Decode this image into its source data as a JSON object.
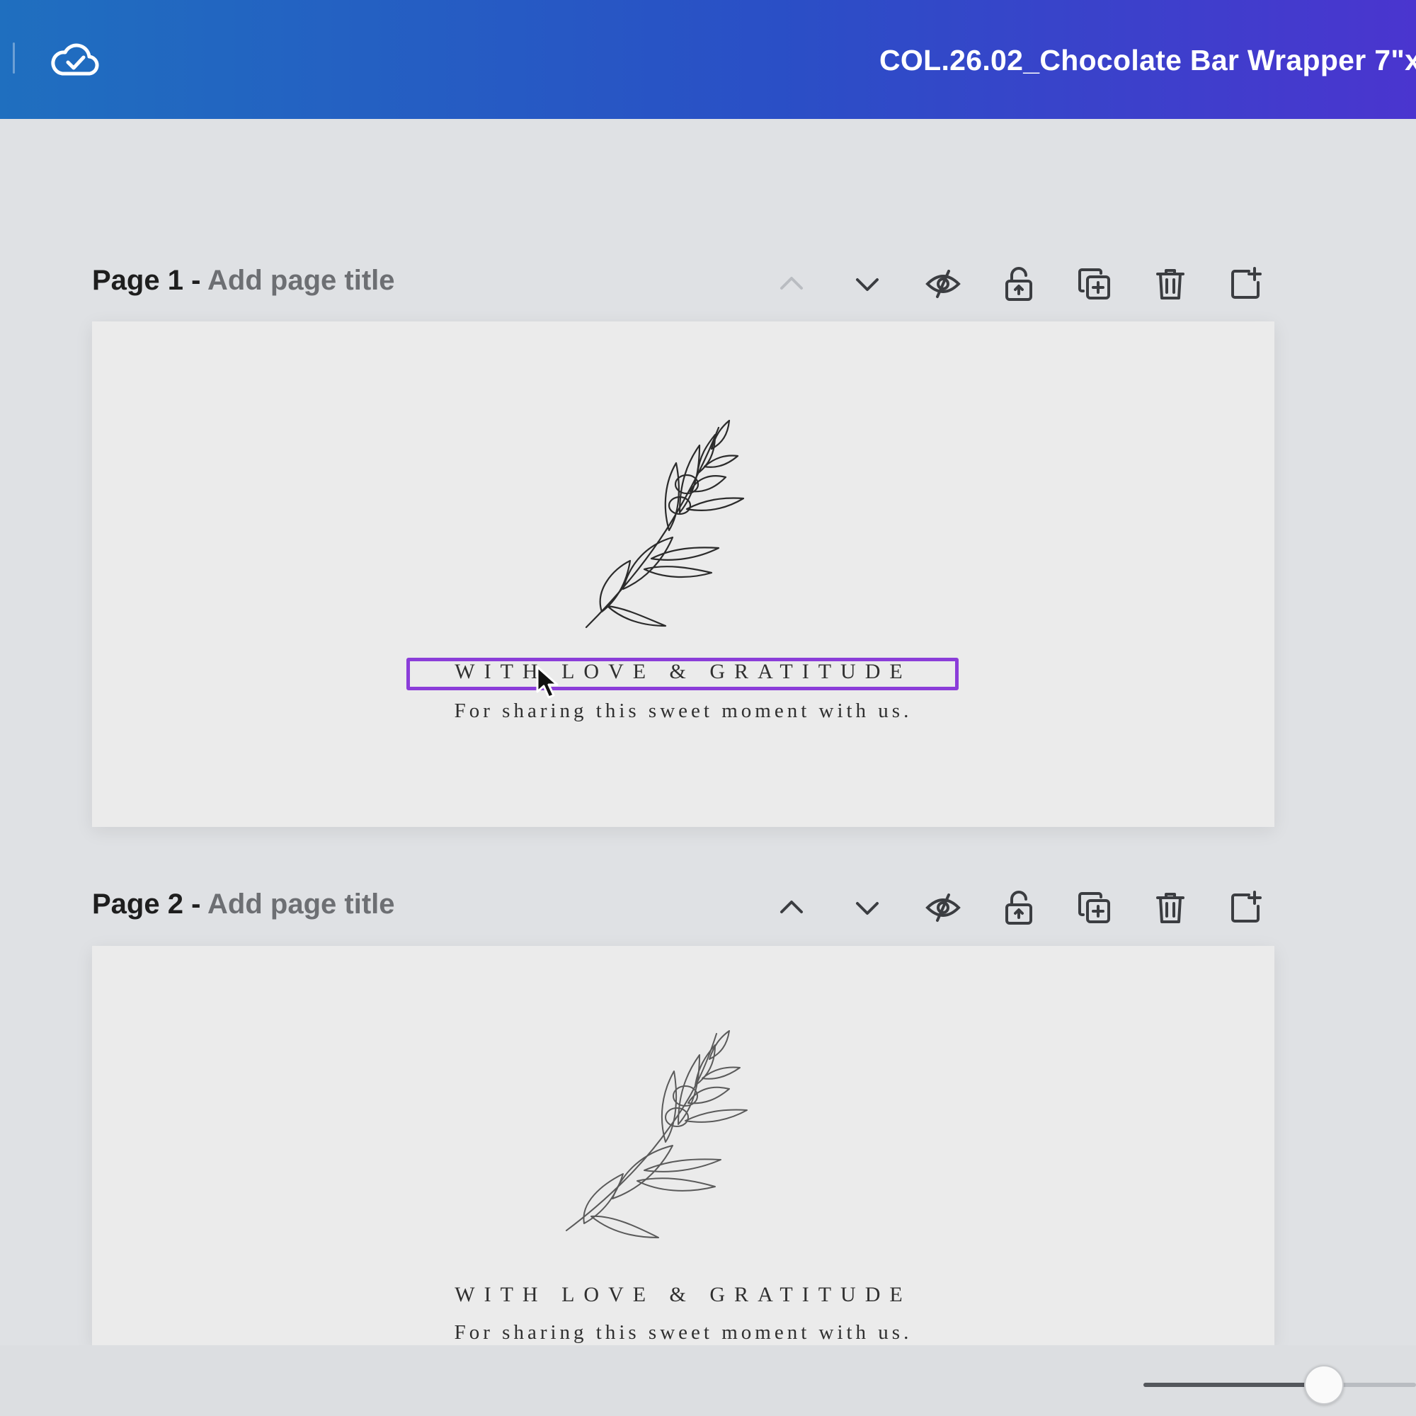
{
  "topbar": {
    "document_title": "COL.26.02_Chocolate Bar Wrapper 7\"x",
    "save_status_icon": "cloud-check-icon"
  },
  "pages": [
    {
      "label": "Page 1 -",
      "title_placeholder": "Add page title",
      "heading": "WITH LOVE & GRATITUDE",
      "subheading": "For sharing this sweet moment with us.",
      "heading_selected": true
    },
    {
      "label": "Page 2 -",
      "title_placeholder": "Add page title",
      "heading": "WITH LOVE & GRATITUDE",
      "subheading": "For sharing this sweet moment with us.",
      "heading_selected": false
    }
  ],
  "page_actions": [
    "move-up-icon",
    "move-down-icon",
    "hide-icon",
    "lock-icon",
    "duplicate-icon",
    "trash-icon",
    "add-page-icon"
  ],
  "colors": {
    "topbar_gradient_start": "#1f6fbf",
    "topbar_gradient_end": "#4a35cf",
    "selection": "#8b3dd9"
  }
}
